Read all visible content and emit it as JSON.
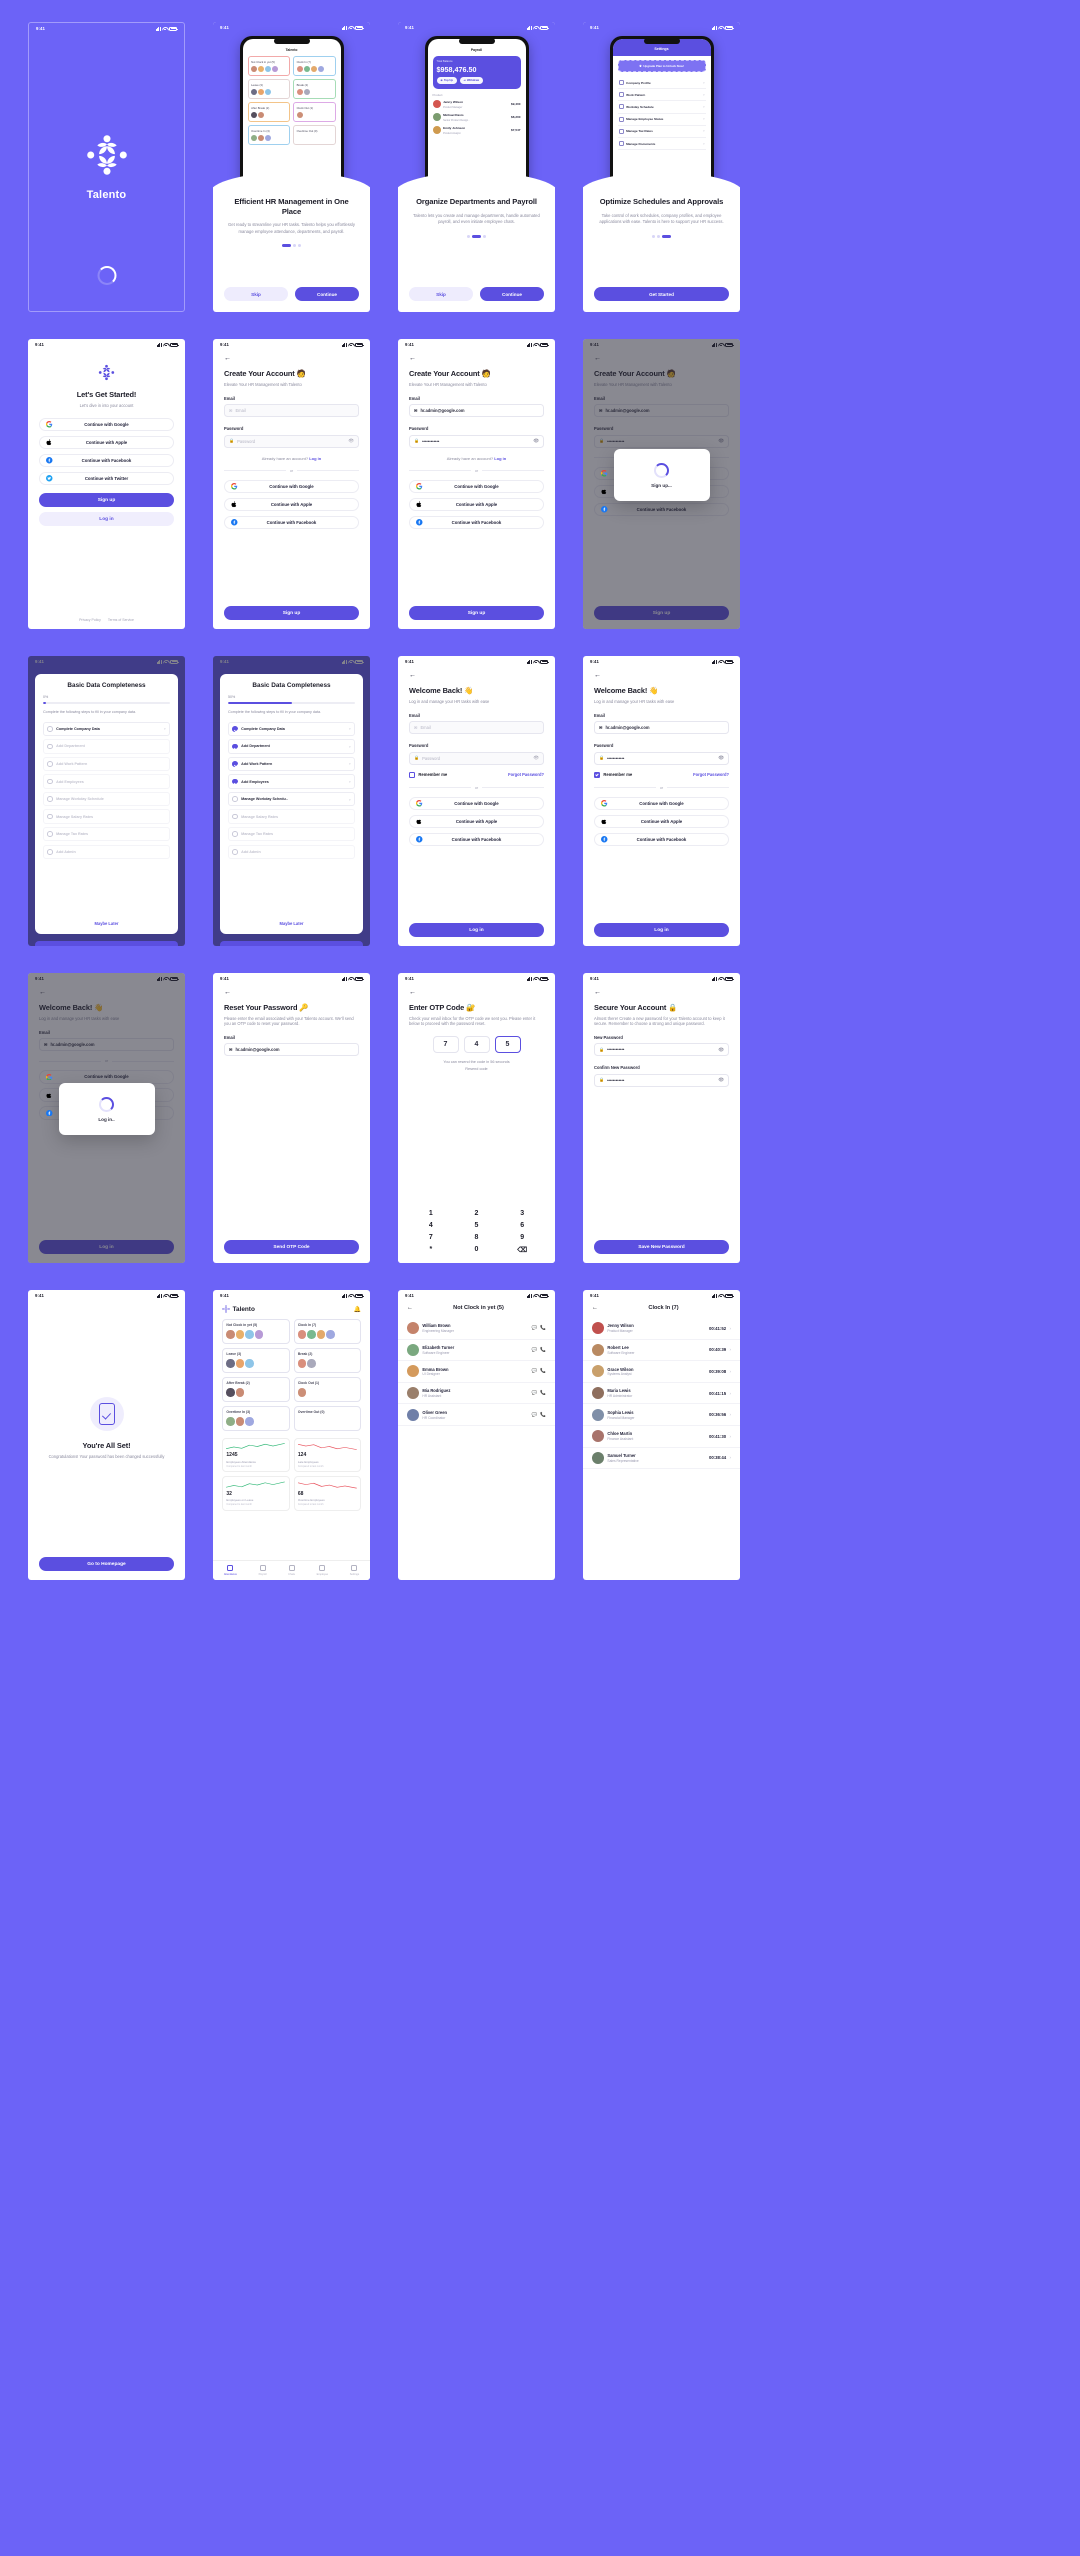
{
  "brand": {
    "name": "Talento",
    "accent": "#5B4FE0",
    "bg": "#6C63F7"
  },
  "status": {
    "time": "9:41"
  },
  "screens": {
    "splash": {
      "name": "Talento"
    },
    "onboarding": [
      {
        "title": "Efficient HR Management in One Place",
        "desc": "Get ready to streamline your HR tasks. Talento helps you effortlessly manage employee attendance, departments, and payroll.",
        "skip": "Skip",
        "next": "Continue",
        "phone_title": "Talento",
        "tiles": [
          {
            "label": "Not Clock in yet (5)",
            "avatars": 4
          },
          {
            "label": "Clock In (7)",
            "avatars": 4
          },
          {
            "label": "Leave (3)",
            "avatars": 3
          },
          {
            "label": "Break (2)",
            "avatars": 2
          },
          {
            "label": "After Break (2)",
            "avatars": 2
          },
          {
            "label": "Clock Out (1)",
            "avatars": 1
          },
          {
            "label": "Overtime In (3)",
            "avatars": 3
          },
          {
            "label": "Overtime Out (0)",
            "avatars": 0
          }
        ]
      },
      {
        "title": "Organize Departments and Payroll",
        "desc": "Talento lets you create and manage departments, handle automated payroll, and even initiate employee chats.",
        "skip": "Skip",
        "next": "Continue",
        "phone_title": "Payroll",
        "pay_label": "Total Balance",
        "pay_amount": "$958,476.50",
        "pay_buttons": [
          "Top Up",
          "Withdraw"
        ],
        "section": "Product",
        "people": [
          {
            "name": "Jenny Wilson",
            "role": "Product Manager",
            "amount": "$9,400"
          },
          {
            "name": "Michael Davis",
            "role": "Senior Product Design..",
            "amount": "$8,200"
          },
          {
            "name": "Emily Johnson",
            "role": "Product Analyst",
            "amount": "$7,547"
          }
        ]
      },
      {
        "title": "Optimize Schedules and Approvals",
        "desc": "Take control of work schedules, company profiles, and employee applications with ease. Talento is here to support your HR success.",
        "cta": "Get Started",
        "phone_title": "Settings",
        "upgrade": "Upgrade Plan to Unlock Now!",
        "rows": [
          "Company Profile",
          "Work Pattern",
          "Workday Schedule",
          "Manage Employee Status",
          "Manage Tax Rates",
          "Manage Documents"
        ]
      }
    ],
    "get_started": {
      "title": "Let's Get Started!",
      "subtitle": "Let's dive in into your account",
      "social": [
        "Continue with Google",
        "Continue with Apple",
        "Continue with Facebook",
        "Continue with Twitter"
      ],
      "signup": "Sign up",
      "login": "Log in",
      "footer": [
        "Privacy Policy",
        "Terms of Service"
      ]
    },
    "create_account": {
      "title": "Create Your Account 🧑",
      "subtitle": "Elevate Your HR Management with Talento",
      "email_label": "Email",
      "email_placeholder": "Email",
      "email_value": "hr.admin@google.com",
      "password_label": "Password",
      "password_placeholder": "Password",
      "password_value": "••••••••••••",
      "have_account": "Already have an account?",
      "login_link": "Log in",
      "or": "or",
      "social": [
        "Continue with Google",
        "Continue with Apple",
        "Continue with Facebook"
      ],
      "cta": "Sign up",
      "loading": "Sign up..."
    },
    "completeness": {
      "title": "Basic Data Completeness",
      "pct_low": "0%",
      "pct_high": "50%",
      "progress_low": 2,
      "progress_high": 50,
      "desc": "Complete the following steps to fill in your company data.",
      "steps_low": [
        {
          "label": "Complete Company Data",
          "done": false,
          "active": true
        },
        {
          "label": "Add Department",
          "done": false,
          "active": false
        },
        {
          "label": "Add Work Pattern",
          "done": false,
          "active": false
        },
        {
          "label": "Add Employees",
          "done": false,
          "active": false
        },
        {
          "label": "Manage Workday Schedule",
          "done": false,
          "active": false
        },
        {
          "label": "Manage Salary Rates",
          "done": false,
          "active": false
        },
        {
          "label": "Manage Tax Rates",
          "done": false,
          "active": false
        },
        {
          "label": "Add Admin",
          "done": false,
          "active": false
        }
      ],
      "steps_high": [
        {
          "label": "Complete Company Data",
          "done": true,
          "active": true
        },
        {
          "label": "Add Department",
          "done": true,
          "active": true
        },
        {
          "label": "Add Work Pattern",
          "done": true,
          "active": true
        },
        {
          "label": "Add Employees",
          "done": true,
          "active": true
        },
        {
          "label": "Manage Workday Schedu..",
          "done": false,
          "active": true
        },
        {
          "label": "Manage Salary Rates",
          "done": false,
          "active": false
        },
        {
          "label": "Manage Tax Rates",
          "done": false,
          "active": false
        },
        {
          "label": "Add Admin",
          "done": false,
          "active": false
        }
      ],
      "maybe_later": "Maybe Later"
    },
    "login": {
      "title": "Welcome Back! 👋",
      "subtitle": "Log in and manage your HR tasks with ease",
      "email_label": "Email",
      "email_placeholder": "Email",
      "email_value": "hr.admin@google.com",
      "password_label": "Password",
      "password_placeholder": "Password",
      "password_value": "••••••••••••",
      "remember": "Remember me",
      "forgot": "Forgot Password?",
      "or": "or",
      "social": [
        "Continue with Google",
        "Continue with Apple",
        "Continue with Facebook"
      ],
      "cta": "Log in",
      "loading": "Log in.."
    },
    "reset_password": {
      "title": "Reset Your Password 🔑",
      "desc": "Please enter the email associated with your Talento account. We'll send you an OTP code to reset your password.",
      "email_label": "Email",
      "email_value": "hr.admin@google.com",
      "cta": "Send OTP Code"
    },
    "otp": {
      "title": "Enter OTP Code 🔐",
      "desc": "Check your email inbox for the OTP code we sent you. Please enter it below to proceed with the password reset.",
      "digits": [
        "7",
        "4",
        "5"
      ],
      "timer": "You can resend the code in 56 seconds",
      "resend": "Resend code",
      "keys": [
        "1",
        "2",
        "3",
        "4",
        "5",
        "6",
        "7",
        "8",
        "9",
        "*",
        "0",
        "⌫"
      ]
    },
    "secure_account": {
      "title": "Secure Your Account 🔒",
      "desc": "Almost there! Create a new password for your Talento account to keep it secure. Remember to choose a strong and unique password.",
      "new_label": "New Password",
      "new_value": "••••••••••••",
      "confirm_label": "Confirm New Password",
      "confirm_value": "••••••••••••",
      "cta": "Save New Password"
    },
    "all_set": {
      "title": "You're All Set!",
      "desc": "Congratulations! Your password has been changed successfully",
      "cta": "Go to Homepage"
    },
    "dashboard": {
      "title": "Talento",
      "tiles": [
        {
          "label": "Not Clock in yet (5)",
          "avatars": 4,
          "tone": "red"
        },
        {
          "label": "Clock In (7)",
          "avatars": 4,
          "tone": "blue"
        },
        {
          "label": "Leave (3)",
          "avatars": 3,
          "tone": "gray"
        },
        {
          "label": "Break (2)",
          "avatars": 2,
          "tone": "green"
        },
        {
          "label": "After Break (2)",
          "avatars": 2,
          "tone": "orange"
        },
        {
          "label": "Clock Out (1)",
          "avatars": 1,
          "tone": "purple"
        },
        {
          "label": "Overtime In (3)",
          "avatars": 3,
          "tone": "blue"
        },
        {
          "label": "Overtime Out (0)",
          "avatars": 0,
          "tone": "gray"
        }
      ],
      "stats": [
        {
          "num": "1245",
          "label": "Employees Attendance",
          "sub": "Compared to last month",
          "color": "#2bb673"
        },
        {
          "num": "124",
          "label": "Late Employees",
          "sub": "Compared to last month",
          "color": "#e8505b"
        },
        {
          "num": "32",
          "label": "Employees on Leave",
          "sub": "Compared to last month",
          "color": "#2bb673"
        },
        {
          "num": "68",
          "label": "Overtime Employees",
          "sub": "Compared to last month",
          "color": "#e8505b"
        }
      ],
      "tabs": [
        "Attendance",
        "Payroll",
        "Chats",
        "Employee",
        "Settings"
      ]
    },
    "not_clocked_list": {
      "title": "Not Clock in yet (5)",
      "people": [
        {
          "name": "William Brown",
          "role": "Engineering Manager"
        },
        {
          "name": "Elizabeth Turner",
          "role": "Software Engineer"
        },
        {
          "name": "Emma Brown",
          "role": "UI Designer"
        },
        {
          "name": "Mia Rodriguez",
          "role": "HR Assistant"
        },
        {
          "name": "Oliver Green",
          "role": "HR Coordinator"
        }
      ]
    },
    "clocked_in_list": {
      "title": "Clock In (7)",
      "people": [
        {
          "name": "Jenny Wilson",
          "role": "Product Manager",
          "time": "00:41:52"
        },
        {
          "name": "Robert Lee",
          "role": "Software Engineer",
          "time": "00:40:39"
        },
        {
          "name": "Grace Wilson",
          "role": "Systems Analyst",
          "time": "00:39:08"
        },
        {
          "name": "Maria Lewis",
          "role": "HR Administrator",
          "time": "00:41:15"
        },
        {
          "name": "Sophia Lewis",
          "role": "Financial Manager",
          "time": "00:36:56"
        },
        {
          "name": "Chloe Martin",
          "role": "Finance Assistant",
          "time": "00:41:30"
        },
        {
          "name": "Samuel Turner",
          "role": "Sales Representative",
          "time": "00:38:44"
        }
      ]
    }
  }
}
